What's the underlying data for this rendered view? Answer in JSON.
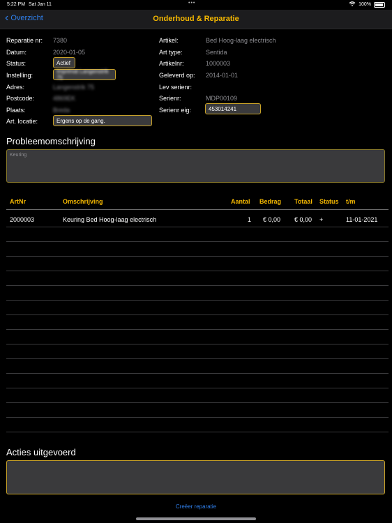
{
  "status_bar": {
    "time": "5:22 PM",
    "date": "Sat Jan 11",
    "battery": "100%"
  },
  "nav": {
    "back_label": "Overzicht",
    "title": "Onderhoud & Reparatie"
  },
  "left_fields": {
    "reparatie_label": "Reparatie nr:",
    "reparatie_value": "7380",
    "datum_label": "Datum:",
    "datum_value": "2020-01-05",
    "status_label": "Status:",
    "status_value": "Actief",
    "instelling_label": "Instelling:",
    "instelling_value": "Imprimat Langenstrik 75",
    "adres_label": "Adres:",
    "adres_value": "Langenstrik 75",
    "postcode_label": "Postcode:",
    "postcode_value": "4869EK",
    "plaats_label": "Plaats:",
    "plaats_value": "Breda",
    "locatie_label": "Art. locatie:",
    "locatie_value": "Ergens op de gang."
  },
  "right_fields": {
    "artikel_label": "Artikel:",
    "artikel_value": "Bed Hoog-laag electrisch",
    "arttype_label": "Art type:",
    "arttype_value": "Sentida",
    "artikelnr_label": "Artikelnr:",
    "artikelnr_value": "1000003",
    "geleverd_label": "Geleverd op:",
    "geleverd_value": "2014-01-01",
    "levserienr_label": "Lev serienr:",
    "levserienr_value": "",
    "serienr_label": "Serienr:",
    "serienr_value": "MDP00109",
    "serienreig_label": "Serienr eig:",
    "serienreig_value": "453014241"
  },
  "problem": {
    "title": "Probleemomschrijving",
    "text": "Keuring"
  },
  "table": {
    "headers": {
      "artnr": "ArtNr",
      "omschrijving": "Omschrijving",
      "aantal": "Aantal",
      "bedrag": "Bedrag",
      "totaal": "Totaal",
      "status": "Status",
      "tm": "t/m"
    },
    "rows": [
      {
        "artnr": "2000003",
        "omschrijving": "Keuring Bed Hoog-laag electrisch",
        "aantal": "1",
        "bedrag": "€ 0,00",
        "totaal": "€ 0,00",
        "status": "+",
        "tm": "11-01-2021"
      }
    ]
  },
  "acties": {
    "title": "Acties uitgevoerd",
    "text": ""
  },
  "footer": {
    "create_link": "Creëer reparatie"
  },
  "colors": {
    "accent": "#f5b800",
    "link": "#2f80ed",
    "field_border": "#c9a227"
  }
}
